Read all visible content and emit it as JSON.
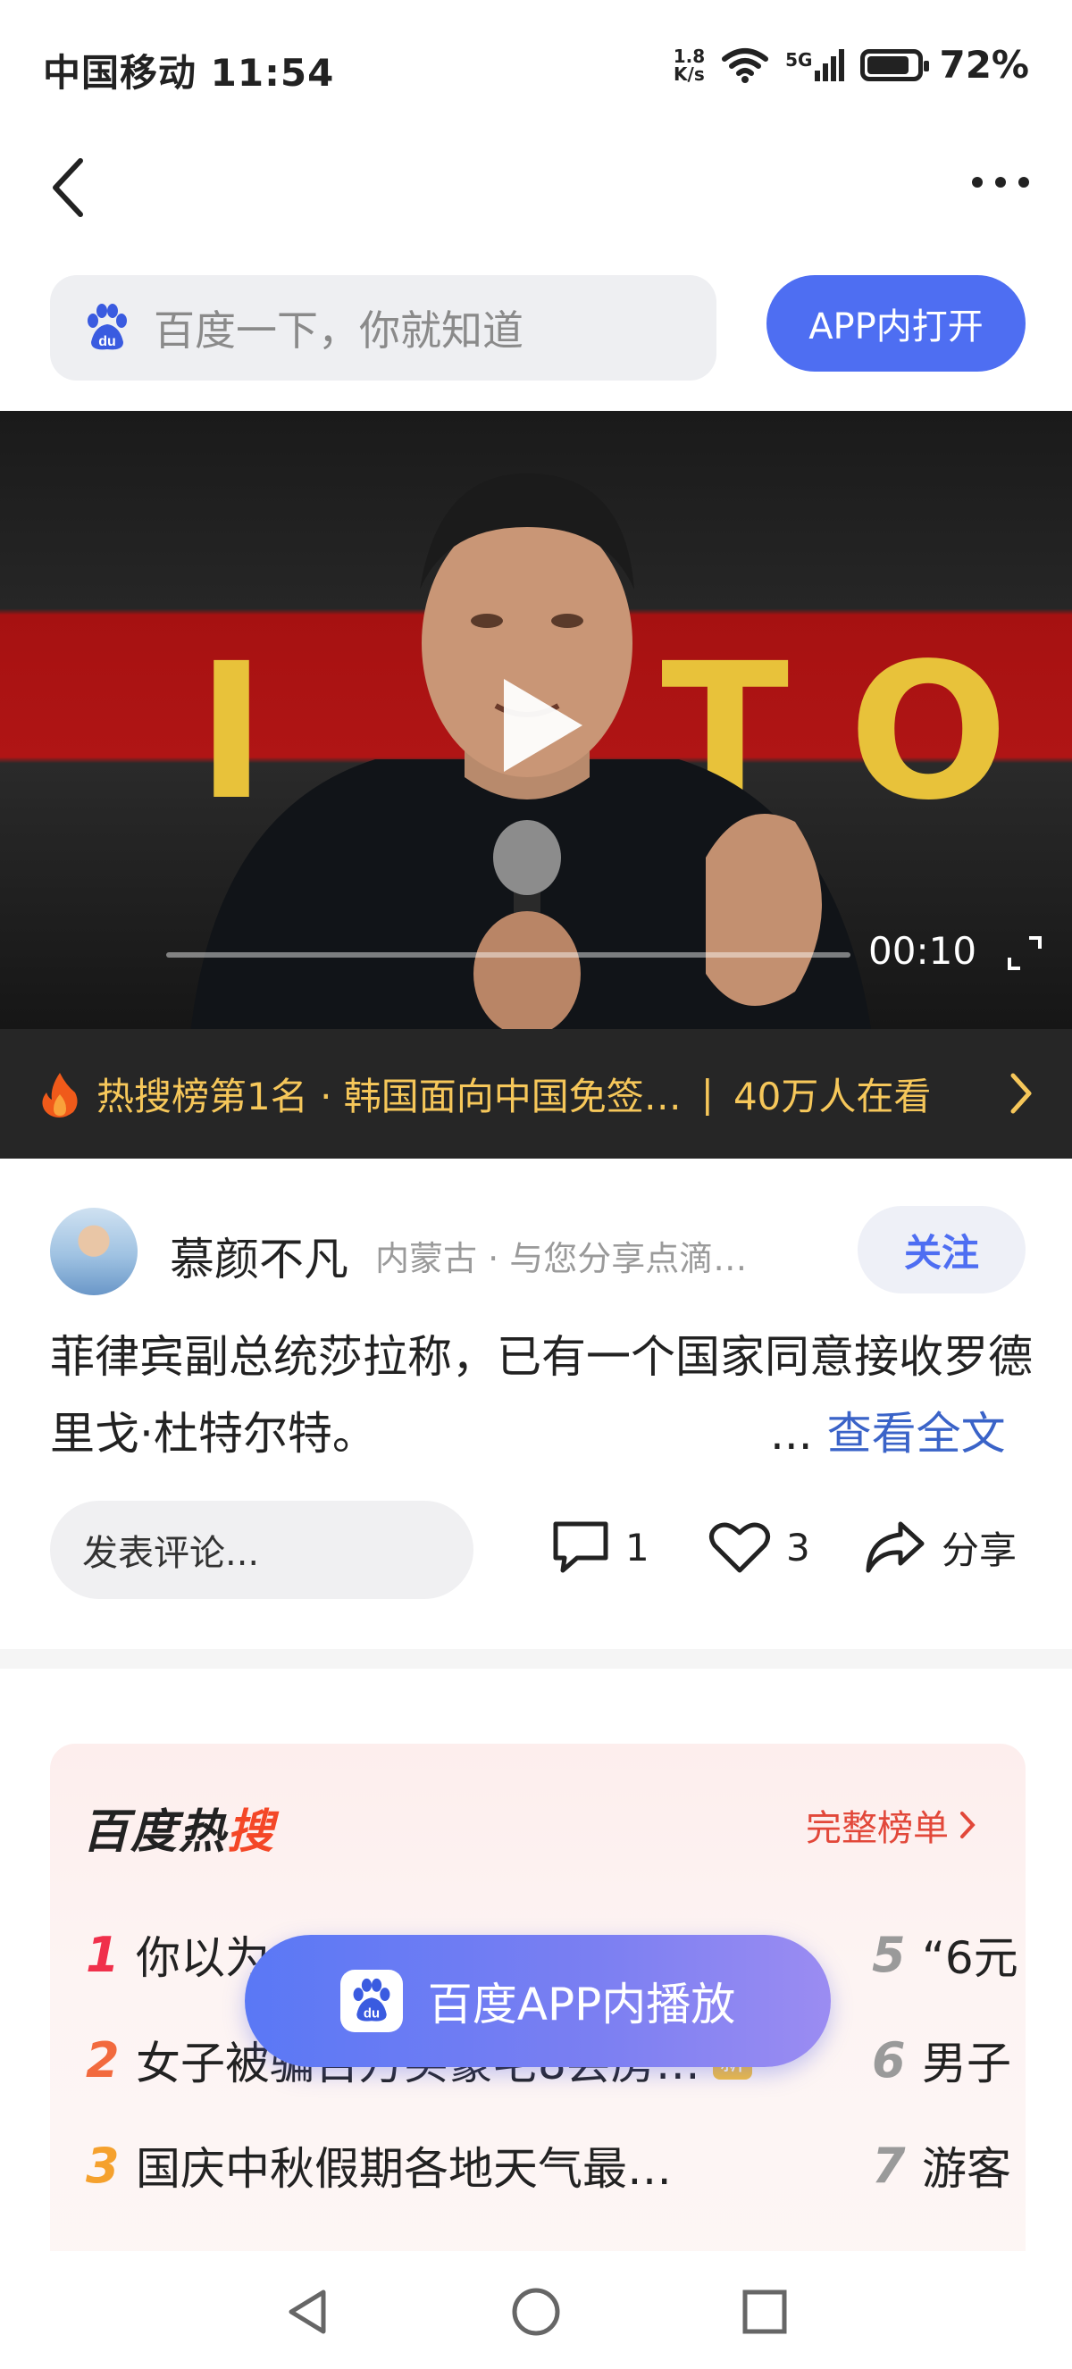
{
  "status_bar": {
    "carrier_time": "中国移动 11:54",
    "net_speed_top": "1.8",
    "net_speed_bottom": "K/s",
    "signal_label": "5G",
    "battery_percent": "72%",
    "battery_level": 0.72
  },
  "search": {
    "placeholder": "百度一下，你就知道",
    "open_app_label": "APP内打开"
  },
  "video": {
    "duration": "00:10",
    "poster_letters": [
      "I",
      "T",
      "O"
    ]
  },
  "hot_banner": {
    "rank_text": "热搜榜第1名 · 韩国面向中国免签…",
    "separator": "|",
    "viewers": "40万人在看"
  },
  "author": {
    "name": "慕颜不凡",
    "meta": "内蒙古 · 与您分享点滴…",
    "follow_label": "关注"
  },
  "post": {
    "text": "菲律宾副总统莎拉称，已有一个国家同意接收罗德里戈·杜特尔特。",
    "ellipsis": "...",
    "read_more": "查看全文"
  },
  "actions": {
    "comment_placeholder": "发表评论...",
    "comment_count": "1",
    "like_count": "3",
    "share_label": "分享"
  },
  "hot_list": {
    "logo_black": "百度热",
    "logo_red": "搜",
    "full_list_label": "完整榜单",
    "items_left": [
      {
        "rank": "1",
        "title": "你以为",
        "badge": ""
      },
      {
        "rank": "2",
        "title": "女子被骗百万买豪宅8尝房…",
        "badge": "新"
      },
      {
        "rank": "3",
        "title": "国庆中秋假期各地天气最…",
        "badge": ""
      }
    ],
    "items_right": [
      {
        "rank": "5",
        "title": "“6元"
      },
      {
        "rank": "6",
        "title": "男子"
      },
      {
        "rank": "7",
        "title": "游客"
      }
    ]
  },
  "float_button": {
    "label": "百度APP内播放"
  },
  "colors": {
    "accent_blue": "#4e6ef2",
    "hot_gold": "#f6c75a",
    "hot_red": "#f44727"
  }
}
